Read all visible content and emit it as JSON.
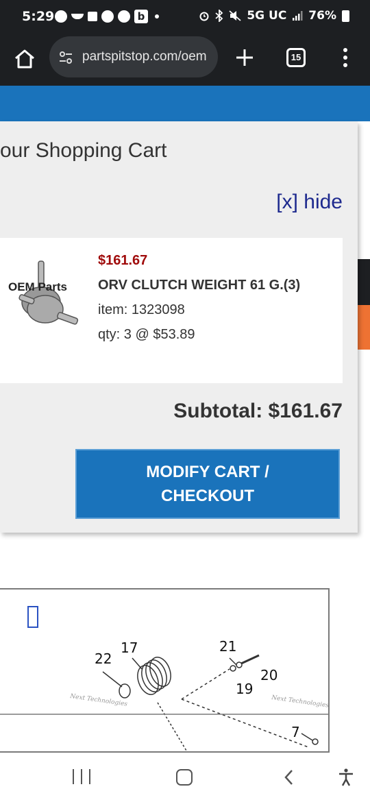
{
  "status_bar": {
    "time": "5:29",
    "network": "5G UC",
    "battery": "76%",
    "notification_icons": [
      "messenger-icon",
      "amazon-icon",
      "slack-icon",
      "facebook-icon",
      "facebook-icon",
      "b-app-icon"
    ],
    "b_label": "b",
    "system_icons": [
      "alarm-icon",
      "bluetooth-icon",
      "mute-icon",
      "signal-icon",
      "battery-icon"
    ]
  },
  "browser": {
    "url": "partspitstop.com/oem",
    "tab_count": "15"
  },
  "cart": {
    "title": "our Shopping Cart",
    "hide_label": "[x] hide",
    "items": [
      {
        "thumbnail_label": "OEM Parts",
        "price": "$161.67",
        "name": "ORV CLUTCH WEIGHT 61 G.(3)",
        "item_number": "item: 1323098",
        "quantity": "qty: 3 @ $53.89"
      }
    ],
    "subtotal": "Subtotal: $161.67",
    "checkout_label": "MODIFY CART / CHECKOUT"
  },
  "diagram": {
    "callouts": [
      "17",
      "21",
      "22",
      "20",
      "19",
      "7"
    ],
    "watermark": "Next Technologies"
  },
  "colors": {
    "brand_blue": "#1a73bb",
    "price_red": "#a00c0c",
    "link_navy": "#1e2a8e",
    "accent_orange": "#ee7233"
  }
}
